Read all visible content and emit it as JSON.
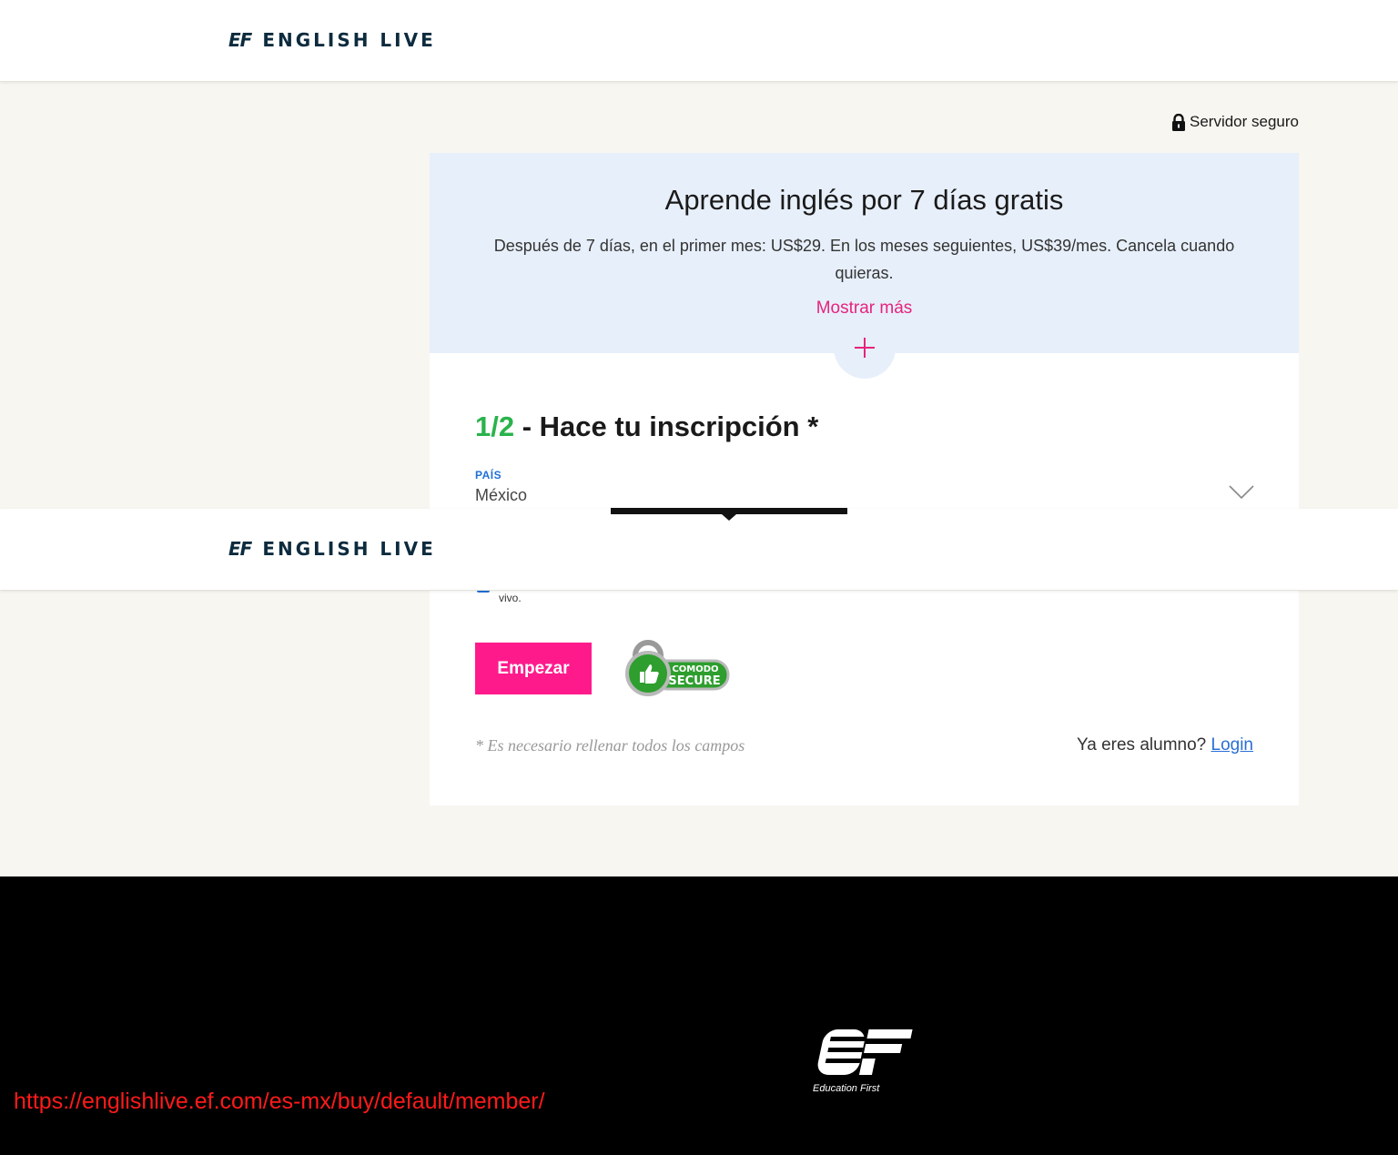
{
  "header": {
    "logo_mark": "EF",
    "logo_name": "ENGLISH LIVE"
  },
  "secure": {
    "label": "Servidor seguro",
    "icon": "lock-icon"
  },
  "promo": {
    "title": "Aprende inglés por 7 días gratis",
    "text": "Después de 7 días, en el primer mes: US$29. En los meses seguientes, US$39/mes. Cancela cuando quieras.",
    "show_more": "Mostrar más",
    "expand_icon": "plus-icon"
  },
  "form": {
    "step_num": "1/2",
    "step_title": " - Hace tu inscripción *",
    "country_label": "PAÍS",
    "country_value": "México",
    "consent_text_fragment": "vivo.",
    "start_button": "Empezar",
    "required_note": "* Es necesario rellenar todos los campos",
    "student_question": "Ya eres alumno? ",
    "login_link": "Login",
    "badge_top": "COMODO",
    "badge_bottom": "SECURE"
  },
  "footer": {
    "logo_mark": "EF",
    "logo_sub": "Education First",
    "url": "https://englishlive.ef.com/es-mx/buy/default/member/"
  },
  "colors": {
    "accent_pink": "#ff1a8c",
    "link_pink": "#e6237e",
    "step_green": "#2ab34b",
    "label_blue": "#1f6fd6",
    "promo_bg": "#e7effa",
    "brand_navy": "#0d2b3e"
  }
}
